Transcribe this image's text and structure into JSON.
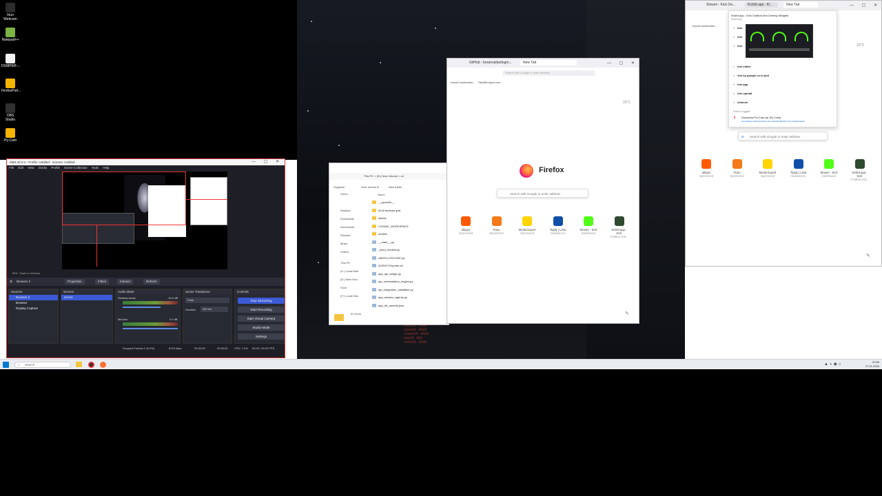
{
  "desktop": {
    "icons": [
      {
        "label": "Iriun Webcam",
        "color": "#2c2c2c"
      },
      {
        "label": "Notepad++",
        "color": "#7cb342"
      },
      {
        "label": "DUMPER-...",
        "color": "#f2f2f2"
      },
      {
        "label": "FirefoxPort...",
        "color": "#f4b400"
      },
      {
        "label": "OBS Studio",
        "color": "#303030"
      },
      {
        "label": "Py-Cam",
        "color": "#f4b400"
      }
    ]
  },
  "obs": {
    "title": "OBS 32.0.4 - Profile: Untitled - Scenes: Untitled",
    "menu": [
      "File",
      "Edit",
      "View",
      "Docks",
      "Profile",
      "Scene Collection",
      "Tools",
      "Help"
    ],
    "source_toolbar": {
      "source": "Browser 2",
      "properties": "Properties",
      "filters": "Filters",
      "interact": "Interact",
      "refresh": "Refresh"
    },
    "sources": {
      "title": "Sources",
      "items": [
        "Browser 2",
        "Browser",
        "Display Capture"
      ]
    },
    "scenes": {
      "title": "Scenes",
      "items": [
        "Scene"
      ]
    },
    "mixer": {
      "title": "Audio Mixer",
      "desktop": "Desktop Audio",
      "desktop_db": "-16.0 dB",
      "mic": "Mic/Aux",
      "mic_db": "0.0 dB"
    },
    "transitions": {
      "title": "Scene Transitions",
      "type": "Fade",
      "duration_label": "Duration",
      "duration": "300 ms"
    },
    "controls": {
      "title": "Controls",
      "buttons": [
        "Stop Streaming",
        "Start Recording",
        "Start Virtual Camera",
        "Studio Mode",
        "Settings"
      ]
    },
    "status": {
      "dropped": "Dropped Frames 0 (0.0%)",
      "kbps": "8744 kbps",
      "time1": "00:30:09",
      "time2": "00:00:00",
      "cpu": "CPU: 1.0%",
      "fps": "60.00 / 60.00 FPS"
    },
    "preview_label": "Scale to Window",
    "zoom": "50%"
  },
  "explorer": {
    "breadcrumb": "This PC  >  (D:) New Volume  >  cd",
    "toolbar": [
      "Organize",
      "Give access to",
      "New folder"
    ],
    "nav": [
      "Home",
      "Desktop",
      "Downloads",
      "Documents",
      "Pictures",
      "Music",
      "Videos",
      "This PC",
      "(C:) Local Disk",
      "(D:) New Volu",
      "Sock",
      "(F:) Local Disk"
    ],
    "column": "Name",
    "files": [
      "__pycache__",
      "9x16 boolean graf",
      "assets",
      "COSMIC_WORKSPACE",
      "models",
      "__main__.py",
      "_fixed_models.py",
      "ABSOLUTECODE.py",
      "AGENT-EXporter.txt",
      "app_api_bridge.py",
      "api_orchestration_engine.py",
      "api_integration_validation.py",
      "app_session_agents.py",
      "app_db_presets.json"
    ],
    "status": "63 items"
  },
  "firefox_mid": {
    "tabs": [
      "GitHub - borarcat/podsgm...",
      "New Tab"
    ],
    "url_placeholder": "Search with Google or enter address",
    "bookmarks": [
      "Import bookmarks...",
      "TartaBA Apps.com"
    ],
    "weather": "22°C",
    "brand": "Firefox",
    "search_placeholder": "Search with Google or enter address",
    "shortcuts": [
      {
        "label": "allegro",
        "sub": "Sponsored",
        "color": "#ff5a00"
      },
      {
        "label": "Temu",
        "sub": "Sponsored",
        "color": "#f57a1a"
      },
      {
        "label": "Media Expert",
        "sub": "Sponsored",
        "color": "#ffd400"
      },
      {
        "label": "Tipply | Lista",
        "sub": "mediatecnic",
        "color": "#0f4fa8"
      },
      {
        "label": "Stream - Kick",
        "sub": "Dashboard",
        "color": "#53fc18"
      },
      {
        "label": "Kickbt.app - Kick",
        "sub": "Chatbot and...",
        "color": "#2f4a2f"
      }
    ]
  },
  "firefox_right": {
    "tabs": [
      "Stream - Kick Da...",
      "Kickbt.app - Ki...",
      "New Tab"
    ],
    "tooltip_title": "Kickbt.app - Kick Chatbot and Overlay Widgets",
    "tooltip_url": "kickbt.app",
    "import": "Import bookmarks...",
    "weather": "22°C",
    "suggestions": [
      "kim",
      "kim",
      "kim",
      "kim editor",
      "kim by google co to just",
      "kim app",
      "kim upload",
      "kimtech"
    ],
    "firefox_suggest": "Firefox Suggest",
    "download": "Download Py Cam.zip (Py Cam)",
    "download_url": "sourceforge.net/projects/py-cam-webcam/files/Py-Cam-zip/download",
    "search_placeholder": "Search with Google or enter address",
    "shortcuts": [
      {
        "label": "allegro",
        "sub": "Sponsored",
        "color": "#ff5a00"
      },
      {
        "label": "Temu",
        "sub": "Sponsored",
        "color": "#f57a1a"
      },
      {
        "label": "Media Expert",
        "sub": "Sponsored",
        "color": "#ffd400"
      },
      {
        "label": "Tipply | Lista",
        "sub": "mediatecnic",
        "color": "#0f4fa8"
      },
      {
        "label": "Stream - Kick",
        "sub": "Dashboard",
        "color": "#53fc18"
      },
      {
        "label": "Kickbt.app - Kick",
        "sub": "Chatbot and...",
        "color": "#2f4a2f"
      }
    ]
  },
  "taskbar": {
    "search_placeholder": "Search",
    "time": "20:56",
    "date": "27.01.2026"
  }
}
